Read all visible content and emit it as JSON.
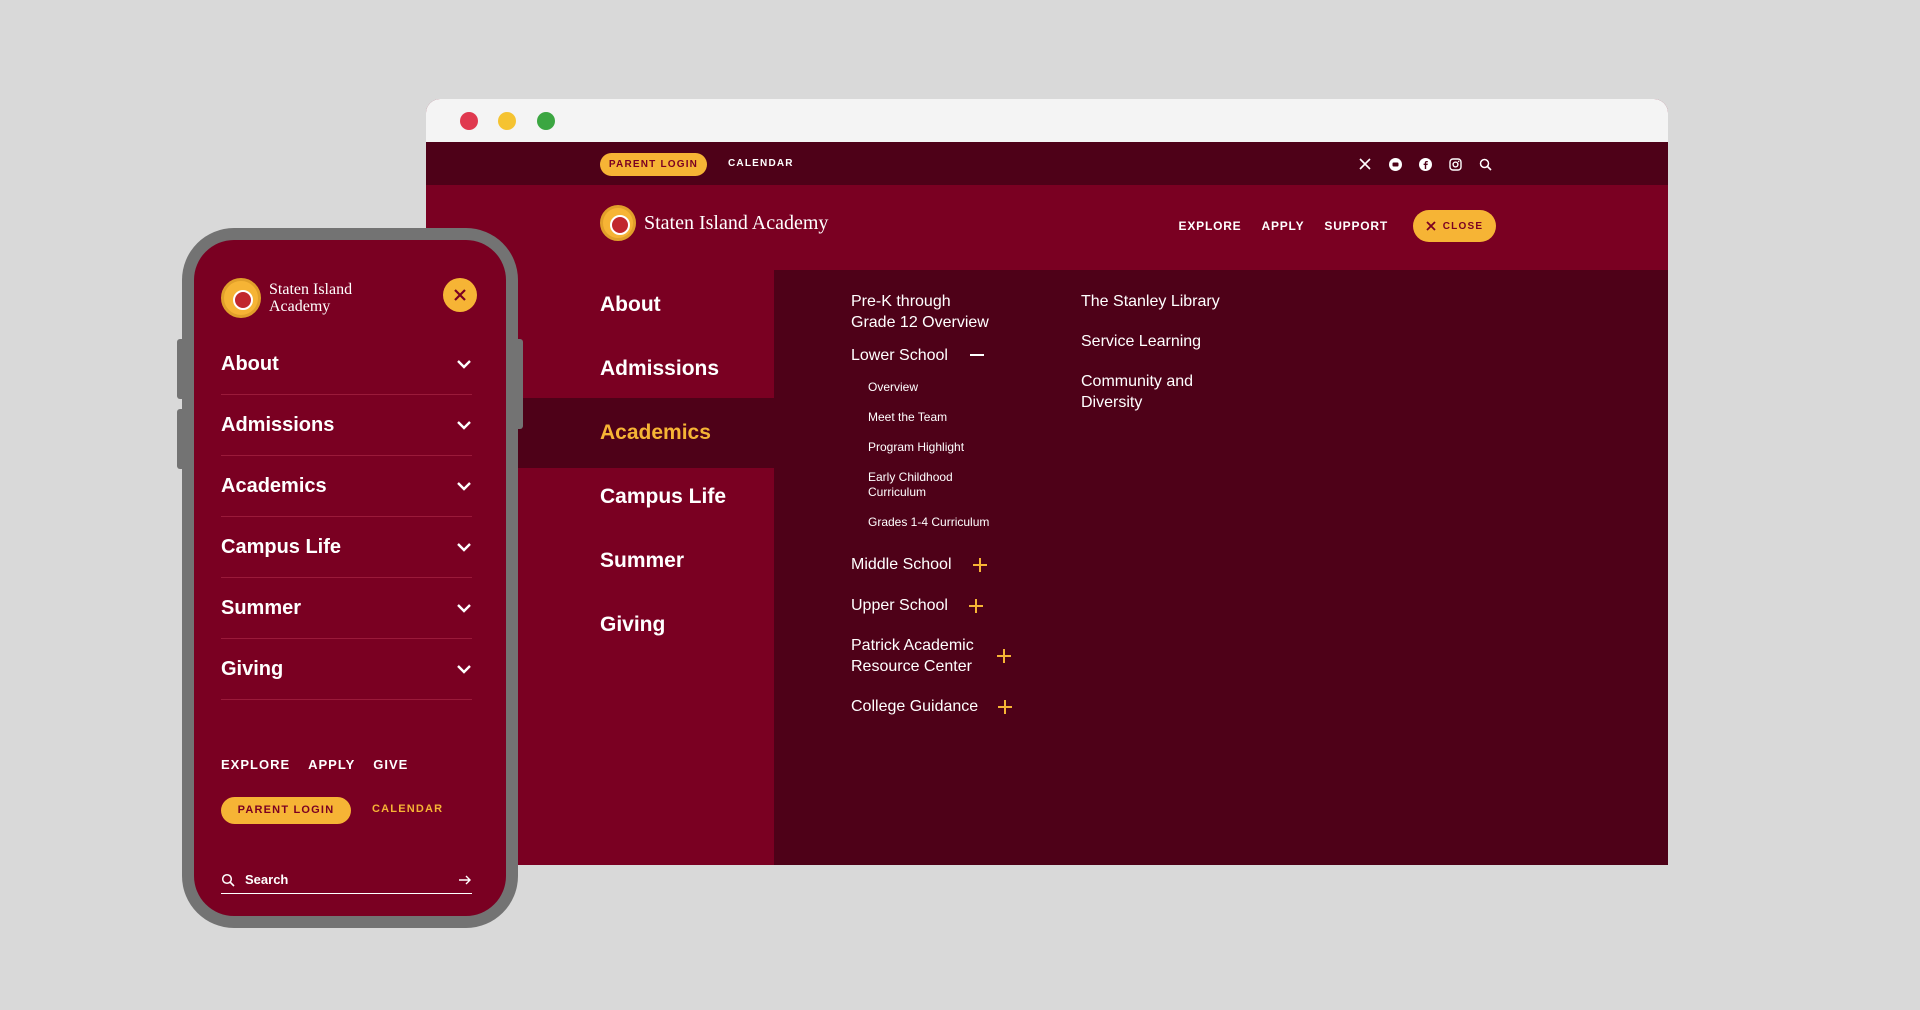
{
  "desktop": {
    "topbar": {
      "parent_login": "PARENT LOGIN",
      "calendar": "CALENDAR"
    },
    "social_icons": [
      "x-icon",
      "youtube-icon",
      "facebook-icon",
      "instagram-icon",
      "search-icon"
    ],
    "logo_text": "Staten Island Academy",
    "nav": {
      "explore": "EXPLORE",
      "apply": "APPLY",
      "support": "SUPPORT",
      "close": "CLOSE"
    },
    "main_menu": [
      "About",
      "Admissions",
      "Academics",
      "Campus Life",
      "Summer",
      "Giving"
    ],
    "active_item": "Academics",
    "academics": {
      "overview": [
        "Pre-K through",
        "Grade 12 Overview"
      ],
      "lower_school": {
        "label": "Lower School",
        "items": [
          "Overview",
          "Meet the Team",
          "Program Highlight",
          "Early Childhood",
          "Curriculum",
          "Grades 1-4 Curriculum"
        ]
      },
      "middle_school": "Middle School",
      "upper_school": "Upper School",
      "parc": [
        "Patrick Academic",
        "Resource Center"
      ],
      "college_guidance": "College Guidance",
      "col2": {
        "library": "The Stanley Library",
        "service": "Service Learning",
        "community": [
          "Community and",
          "Diversity"
        ]
      }
    }
  },
  "mobile": {
    "logo_lines": [
      "Staten Island",
      "Academy"
    ],
    "menu": [
      "About",
      "Admissions",
      "Academics",
      "Campus Life",
      "Summer",
      "Giving"
    ],
    "links": {
      "explore": "EXPLORE",
      "apply": "APPLY",
      "give": "GIVE"
    },
    "parent_login": "PARENT LOGIN",
    "calendar": "CALENDAR",
    "search_placeholder": "Search"
  },
  "colors": {
    "maroon": "#7a0022",
    "dark_maroon": "#4e0118",
    "gold": "#f6b435",
    "background": "#d9d9d9"
  }
}
